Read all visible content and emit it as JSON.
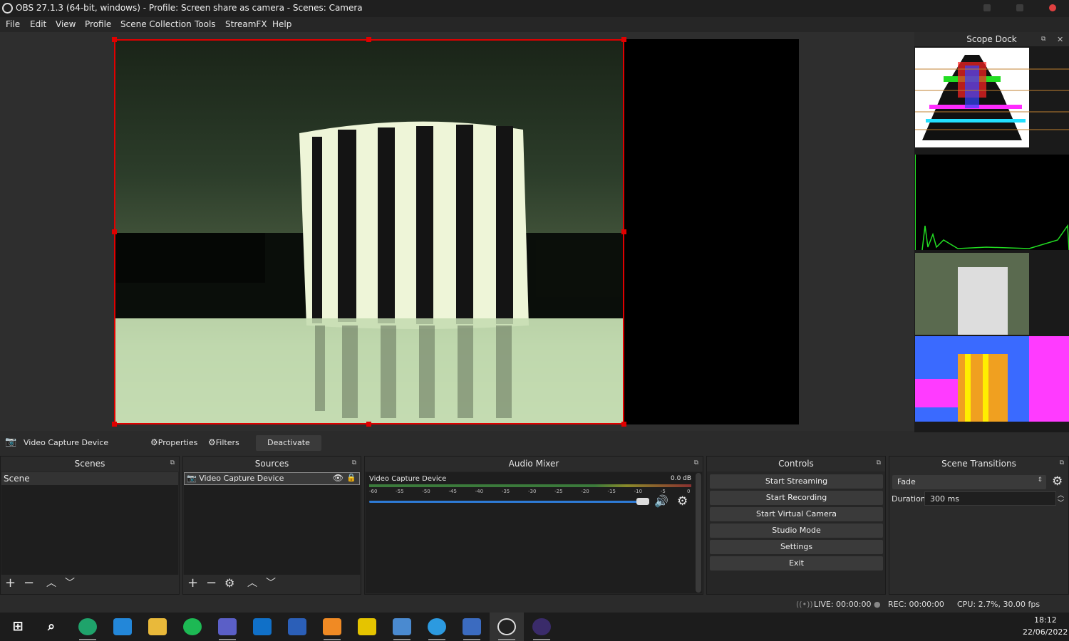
{
  "window": {
    "title": "OBS 27.1.3 (64-bit, windows) - Profile: Screen share as camera - Scenes: Camera"
  },
  "menu": [
    "File",
    "Edit",
    "View",
    "Profile",
    "Scene Collection",
    "Tools",
    "StreamFX",
    "Help"
  ],
  "scope_dock": {
    "title": "Scope Dock"
  },
  "context_bar": {
    "source_name": "Video Capture Device",
    "properties": "Properties",
    "filters": "Filters",
    "deactivate": "Deactivate"
  },
  "scenes": {
    "title": "Scenes",
    "items": [
      "Scene"
    ]
  },
  "sources": {
    "title": "Sources",
    "items": [
      "Video Capture Device"
    ]
  },
  "audio_mixer": {
    "title": "Audio Mixer",
    "channel_name": "Video Capture Device",
    "level": "0.0 dB",
    "ticks": [
      "-60",
      "-55",
      "-50",
      "-45",
      "-40",
      "-35",
      "-30",
      "-25",
      "-20",
      "-15",
      "-10",
      "-5",
      "0"
    ],
    "volume_fraction": 1.0
  },
  "controls": {
    "title": "Controls",
    "buttons": [
      "Start Streaming",
      "Start Recording",
      "Start Virtual Camera",
      "Studio Mode",
      "Settings",
      "Exit"
    ]
  },
  "scene_transitions": {
    "title": "Scene Transitions",
    "transition": "Fade",
    "duration_label": "Duration",
    "duration_value": "300 ms"
  },
  "status": {
    "live": "LIVE: 00:00:00",
    "rec": "REC: 00:00:00",
    "cpu": "CPU: 2.7%, 30.00 fps"
  },
  "taskbar": {
    "time": "18:12",
    "date": "22/06/2022"
  },
  "colors": {
    "selection": "#e00000",
    "accent": "#2e7bd6"
  }
}
